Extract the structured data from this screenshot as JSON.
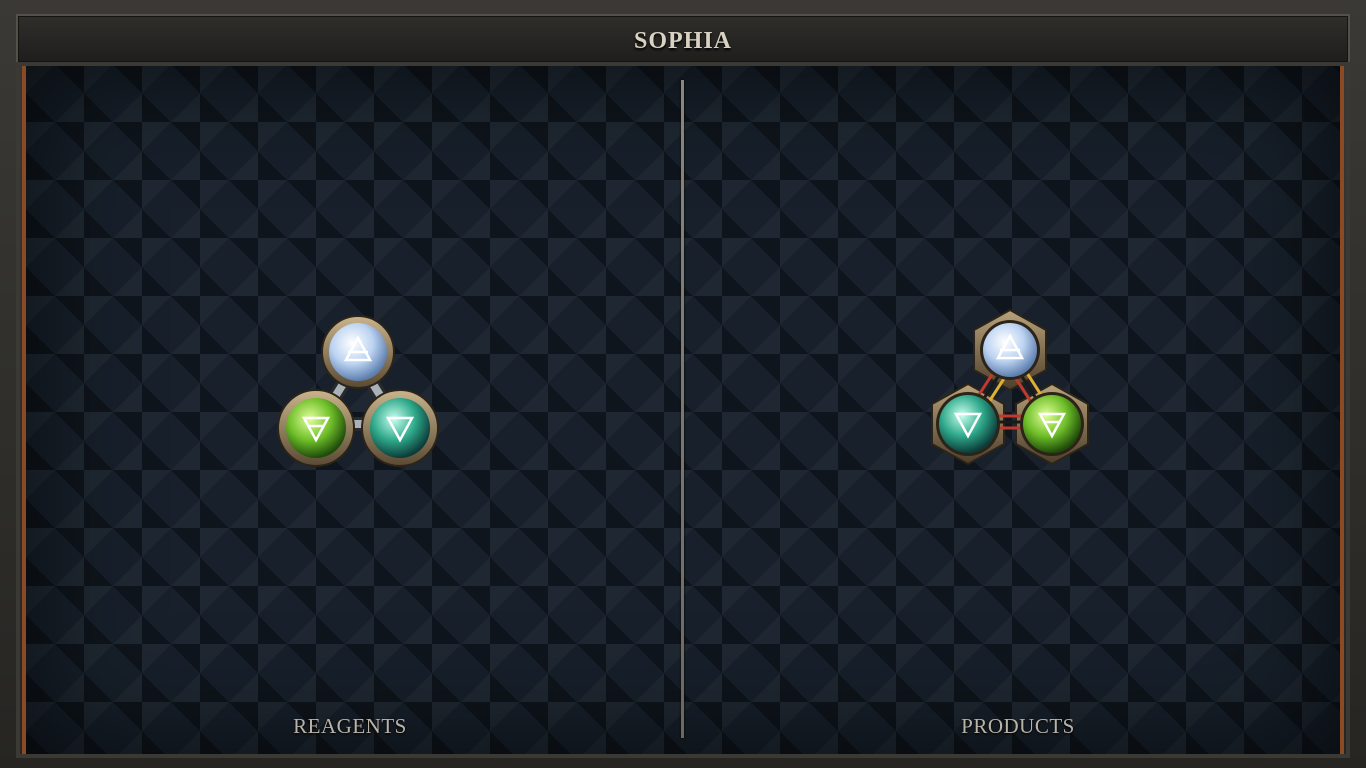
{
  "header": {
    "title": "SOPHIA"
  },
  "panels": {
    "reagents": {
      "label": "REAGENTS",
      "atoms": [
        {
          "element": "air",
          "symbol": "air-icon",
          "color": "#bcd3f2"
        },
        {
          "element": "earth",
          "symbol": "earth-icon",
          "color": "#6fbf2a"
        },
        {
          "element": "water",
          "symbol": "water-icon",
          "color": "#2fa98a"
        }
      ]
    },
    "products": {
      "label": "PRODUCTS",
      "atoms": [
        {
          "element": "air",
          "symbol": "air-icon",
          "color": "#bcd3f2"
        },
        {
          "element": "water",
          "symbol": "water-icon",
          "color": "#2fa98a"
        },
        {
          "element": "earth",
          "symbol": "earth-icon",
          "color": "#6fbf2a"
        }
      ]
    }
  },
  "colors": {
    "frame": "#2b2a27",
    "board": "#17202b",
    "accent_trim": "#8a4a25",
    "bond_silver": "#9aa3a8",
    "bond_triplex_red": "#c0392b",
    "bond_triplex_yellow": "#e0b030"
  }
}
